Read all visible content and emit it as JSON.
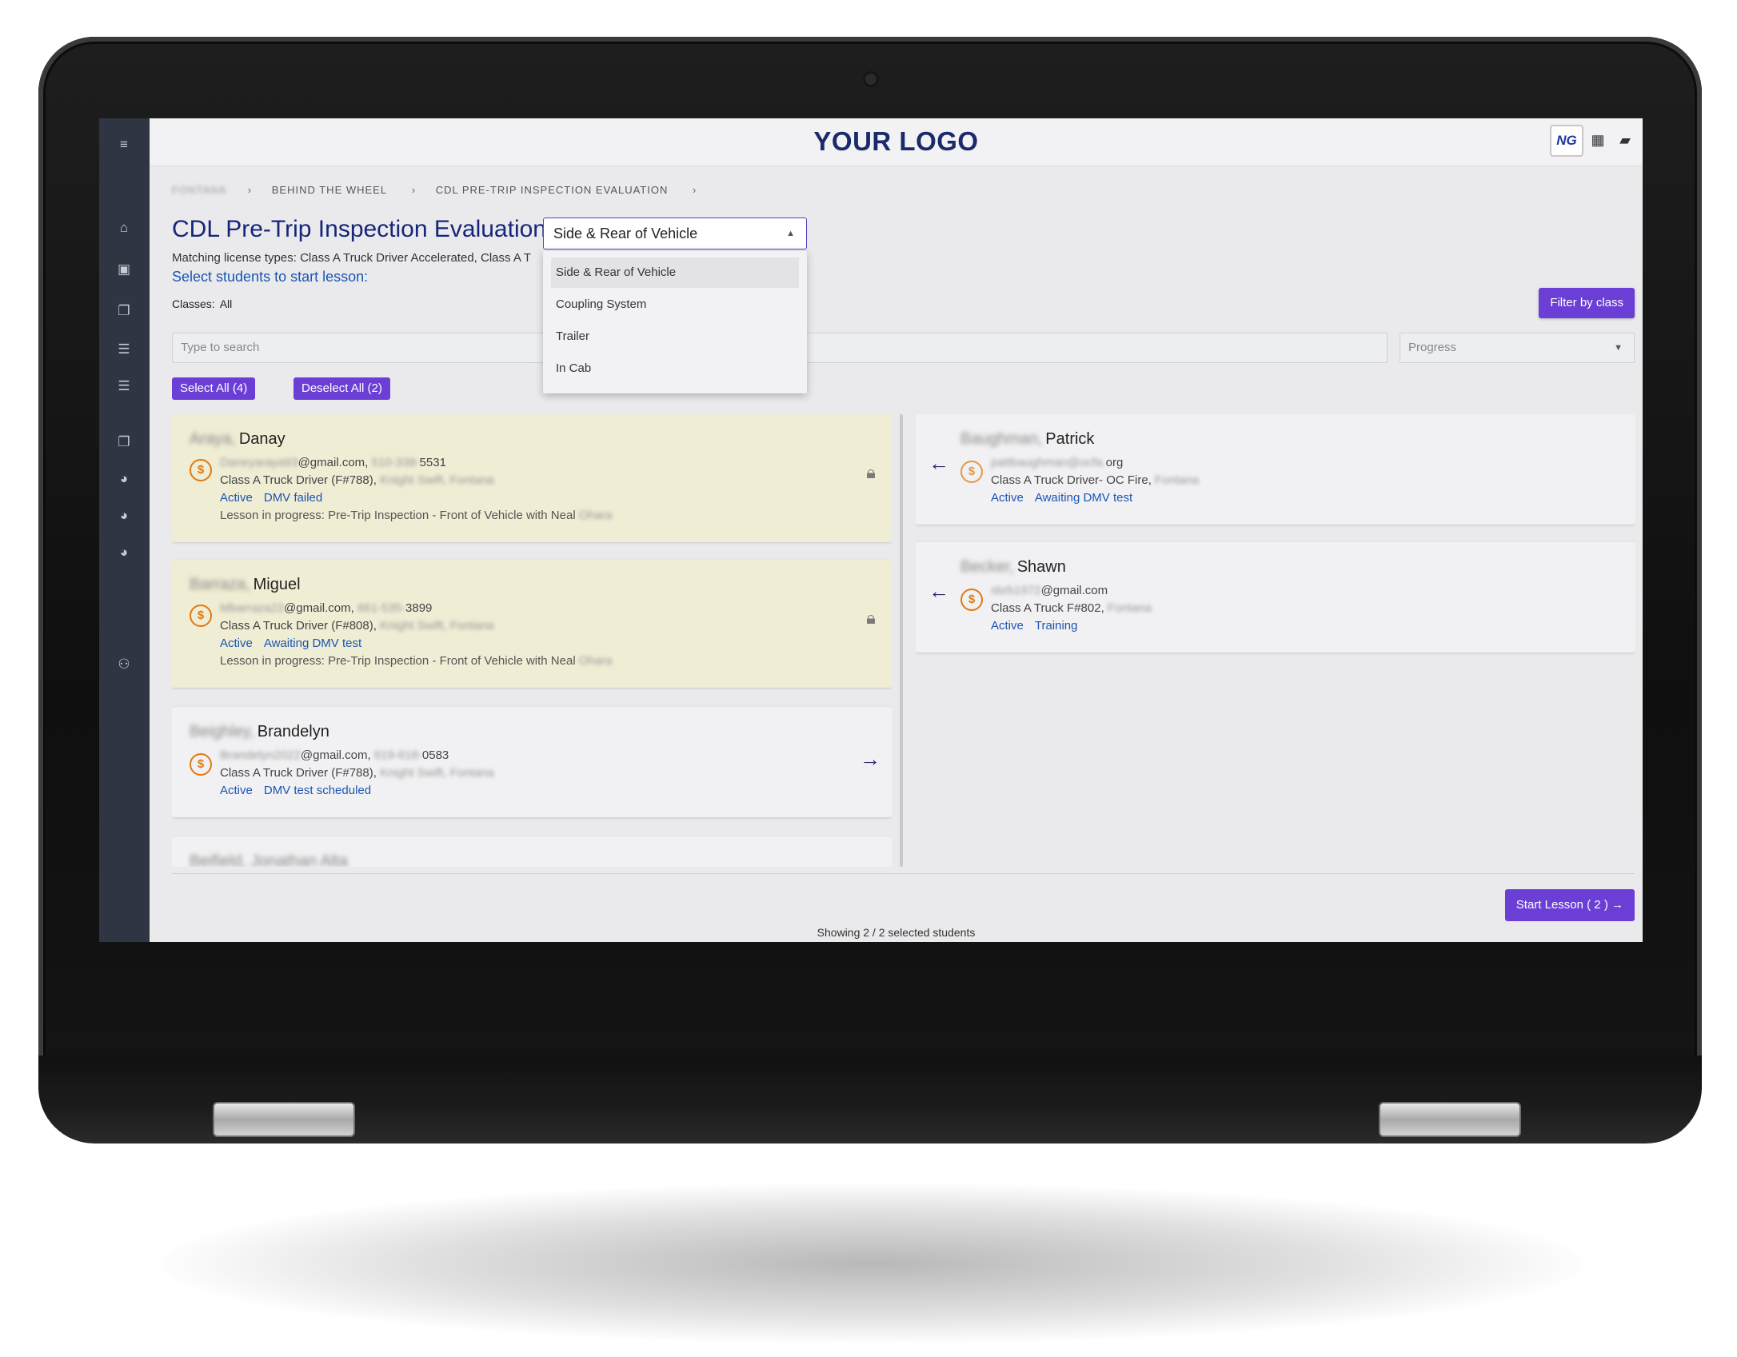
{
  "app": {
    "logo_text": "YOUR LOGO",
    "avatar_initials": "NG",
    "accent_color": "#6b3fd6",
    "title_color": "#17267a",
    "link_color": "#1a55b3"
  },
  "sidebar": {
    "icons": [
      "menu-icon",
      "home-icon",
      "calendar-icon",
      "copy-icon",
      "list-icon",
      "list-icon",
      "copy-icon",
      "chat-person-icon",
      "chat-person-icon",
      "chat-person-icon",
      "users-icon"
    ]
  },
  "breadcrumb": {
    "blurred": "FONTANA",
    "items": [
      "BEHIND THE WHEEL",
      "CDL PRE-TRIP INSPECTION EVALUATION"
    ]
  },
  "page": {
    "title": "CDL Pre-Trip Inspection Evaluation",
    "matching": "Matching license types: Class A Truck Driver Accelerated, Class A T",
    "select_prompt": "Select students to start lesson:",
    "classes_label": "Classes:",
    "classes_value": "All",
    "filter_label": "Filter by class",
    "search_placeholder": "Type to search",
    "progress_placeholder": "Progress",
    "select_all": "Select All (4)",
    "deselect_all": "Deselect All (2)",
    "start_lesson": "Start Lesson ( 2 )",
    "showing": "Showing 2 / 2 selected students"
  },
  "lesson_select": {
    "value": "Side & Rear of Vehicle",
    "options": [
      "Side & Rear of Vehicle",
      "Coupling System",
      "Trailer",
      "In Cab"
    ]
  },
  "available_students": [
    {
      "last": "Araya,",
      "first": "Danay",
      "email_hidden": "Daneyaraya93",
      "email_domain": "@gmail.com,",
      "phone_hidden": "510-338-",
      "phone_tail": "5531",
      "license": "Class A Truck Driver (F#788),",
      "location_hidden": "Knight Swift, Fontana",
      "status": "Active",
      "progress": "DMV failed",
      "lesson_note": "Lesson in progress: Pre-Trip Inspection - Front of Vehicle with Neal",
      "instructor_hidden": "Ohara"
    },
    {
      "last": "Barraza,",
      "first": "Miguel",
      "email_hidden": "Mbarraza22",
      "email_domain": "@gmail.com,",
      "phone_hidden": "661-535-",
      "phone_tail": "3899",
      "license": "Class A Truck Driver (F#808),",
      "location_hidden": "Knight Swift, Fontana",
      "status": "Active",
      "progress": "Awaiting DMV test",
      "lesson_note": "Lesson in progress: Pre-Trip Inspection - Front of Vehicle with Neal",
      "instructor_hidden": "Ohara"
    },
    {
      "last": "Beighley,",
      "first": "Brandelyn",
      "email_hidden": "Brandelyn2022",
      "email_domain": "@gmail.com,",
      "phone_hidden": "619-618-",
      "phone_tail": "0583",
      "license": "Class A Truck Driver (F#788),",
      "location_hidden": "Knight Swift, Fontana",
      "status": "Active",
      "progress": "DMV test scheduled"
    },
    {
      "partial_name": "Beifield, Jonathan Alta"
    }
  ],
  "selected_students": [
    {
      "last": "Baughman,",
      "first": "Patrick",
      "email_hidden": "pattbaughman@ocfa.",
      "email_domain": "org",
      "license": "Class A Truck Driver- OC Fire,",
      "location_hidden": "Fontana",
      "status": "Active",
      "progress": "Awaiting DMV test"
    },
    {
      "last": "Becker,",
      "first": "Shawn",
      "email_hidden": "sbrb1972",
      "email_domain": "@gmail.com",
      "license": "Class A Truck F#802,",
      "location_hidden": "Fontana",
      "status": "Active",
      "progress": "Training"
    }
  ]
}
